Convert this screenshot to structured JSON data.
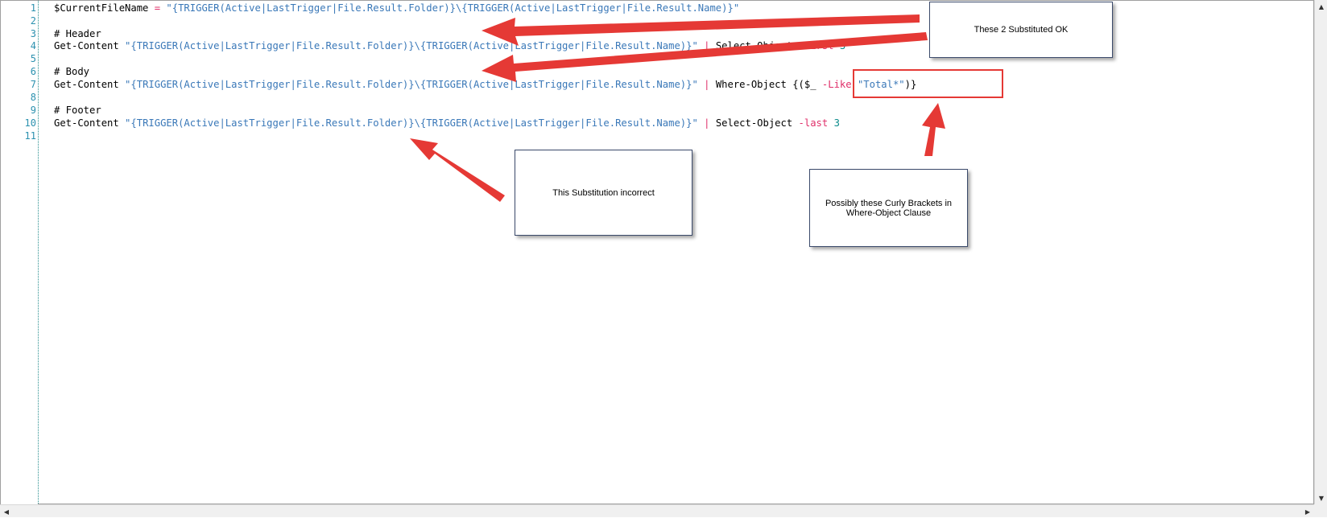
{
  "editor": {
    "line_numbers": [
      "1",
      "2",
      "3",
      "4",
      "5",
      "6",
      "7",
      "8",
      "9",
      "10",
      "11"
    ],
    "lines": {
      "l1": {
        "var": "$CurrentFileName",
        "op": " = ",
        "str": "\"{TRIGGER(Active|LastTrigger|File.Result.Folder)}\\{TRIGGER(Active|LastTrigger|File.Result.Name)}\""
      },
      "l3": {
        "comment": "# Header"
      },
      "l4": {
        "cmd": "Get-Content",
        "str": " \"{TRIGGER(Active|LastTrigger|File.Result.Folder)}\\{TRIGGER(Active|LastTrigger|File.Result.Name)}\"",
        "pipe": " | ",
        "cmd2": "Select-Object",
        "opt": " -first ",
        "num": "3"
      },
      "l6": {
        "comment": "# Body"
      },
      "l7": {
        "cmd": "Get-Content",
        "str": " \"{TRIGGER(Active|LastTrigger|File.Result.Folder)}\\{TRIGGER(Active|LastTrigger|File.Result.Name)}\"",
        "pipe": " | ",
        "cmd2": "Where-Object",
        "rest1": " {($_ ",
        "opt": "-Like",
        "rest2": " ",
        "str2": "\"Total*\"",
        "rest3": ")}"
      },
      "l9": {
        "comment": "# Footer"
      },
      "l10": {
        "cmd": "Get-Content",
        "str": " \"{TRIGGER(Active|LastTrigger|File.Result.Folder)}\\{TRIGGER(Active|LastTrigger|File.Result.Name)}\"",
        "pipe": " | ",
        "cmd2": "Select-Object",
        "opt": " -last ",
        "num": "3"
      }
    }
  },
  "callouts": {
    "ok": "These 2 Substituted OK",
    "incorrect": "This Substitution incorrect",
    "brackets": "Possibly these Curly Brackets in Where-Object Clause"
  },
  "scrollbar": {
    "left": "◀",
    "right": "▶",
    "up": "▲",
    "down": "▼"
  },
  "colors": {
    "arrow": "#e53935",
    "string": "#3a78b8",
    "operator": "#e0306a",
    "line_number": "#2b91af"
  }
}
